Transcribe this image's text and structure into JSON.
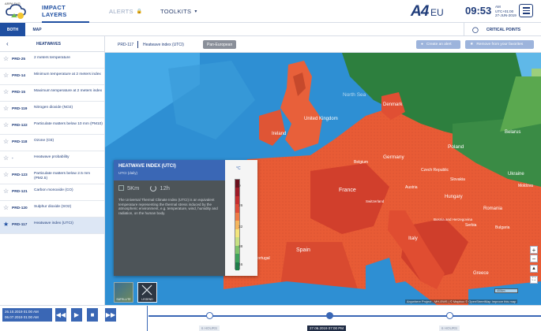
{
  "brand": {
    "logo_text": "ARPA FVG",
    "name": "A4",
    "region": "EU"
  },
  "nav": {
    "impact_layers": "IMPACT LAYERS",
    "alerts": "ALERTS",
    "tools": "TOOLKITS"
  },
  "clock": {
    "time": "09:53",
    "ampm": "AM",
    "tz": "UTC+01:00",
    "date": "27-JUN-2019"
  },
  "subbar": {
    "both": "BOTH",
    "map": "MAP",
    "critical_points": "CRITICAL POINTS"
  },
  "sidebar": {
    "title": "HEATWAVES",
    "items": [
      {
        "code": "PRD-25",
        "name": "2 meters temperature"
      },
      {
        "code": "PRD-14",
        "name": "Minimum temperature at 2 meters index"
      },
      {
        "code": "PRD-15",
        "name": "Maximum temperature at 2 meters index"
      },
      {
        "code": "PRD-119",
        "name": "Nitrogen dioxide (NO2)"
      },
      {
        "code": "PRD-122",
        "name": "Particulate matters below 10 mm (PM10)"
      },
      {
        "code": "PRD-118",
        "name": "Ozone (O3)"
      },
      {
        "code": "-",
        "name": "Heatwave probability"
      },
      {
        "code": "PRD-123",
        "name": "Particulate matters below 2.5 mm (PM2.5)"
      },
      {
        "code": "PRD-121",
        "name": "Carbon monoxide (CO)"
      },
      {
        "code": "PRD-120",
        "name": "Sulphur dioxide (SO2)"
      },
      {
        "code": "PRD-117",
        "name": "Heatwave index (UTCI)"
      }
    ]
  },
  "map_header": {
    "code": "PRD-117",
    "name": "Heatwave index (UTCI)",
    "chip": "Pan-European",
    "create_alert": "Create an alert",
    "remove_favorites": "Remove from your favorites"
  },
  "map_labels": {
    "north_sea": "North Sea",
    "denmark": "Denmark",
    "united_kingdom": "United Kingdom",
    "ireland": "Ireland",
    "belgium": "Belgium",
    "germany": "Germany",
    "poland": "Poland",
    "belarus": "Belarus",
    "ukraine": "Ukraine",
    "czech": "Czech Republic",
    "slovakia": "Slovakia",
    "austria": "Austria",
    "hungary": "Hungary",
    "france": "France",
    "switzerland": "Switzerland",
    "romania": "Romania",
    "moldova": "Moldova",
    "italy": "Italy",
    "spain": "Spain",
    "portugal": "Portugal",
    "bosnia": "Bosnia and Herzegovina",
    "serbia": "Serbia",
    "bulgaria": "Bulgaria",
    "greece": "Greece",
    "attribution": "Anywhere Project - MH-EWS | © Mapbox © OpenStreetMap Improve this map",
    "scalebar": "400km"
  },
  "legend": {
    "title": "HEATWAVE INDEX (UTCI)",
    "subtitle": "UTCI (daily)",
    "unit": "°C",
    "resolution": "5Km",
    "frequency": "12h",
    "description": "The Universal Thermal Climate Index (UTCI) is an equivalent temperature representing the thermal stress induced by the atmospheric environment, e.g. temperature, wind, humidity and radiation, on the human body.",
    "scale_labels": [
      "9",
      "26",
      "32",
      "38",
      "46"
    ],
    "scale_colors": [
      "#1f7d4a",
      "#3da15a",
      "#7dc36a",
      "#c7e081",
      "#f3e57c",
      "#f5b55c",
      "#ef7b45",
      "#df4b37",
      "#c62d2e",
      "#9e1b27",
      "#6b0f1c"
    ],
    "satellite": "SATELLITE",
    "legend_btn": "LEGEND"
  },
  "timeline": {
    "from": "26.10.2019 01:00 AM",
    "to": "06.07.2019 01:00 AM",
    "labels": [
      {
        "text": "6 HOURS",
        "kind": "minor"
      },
      {
        "text": "27.06.2019 07:00 PM",
        "kind": "major"
      },
      {
        "text": "6 HOURS",
        "kind": "minor"
      }
    ]
  }
}
